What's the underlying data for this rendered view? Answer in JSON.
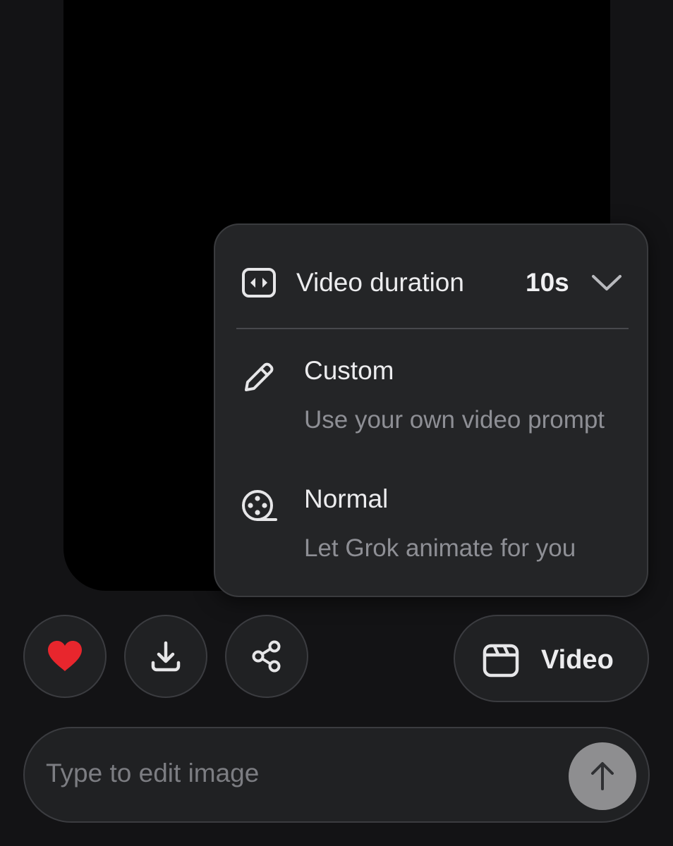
{
  "image_preview": {},
  "video_menu": {
    "duration": {
      "icon": "duration-icon",
      "label": "Video duration",
      "value": "10s",
      "dropdown_icon": "chevron-down-icon"
    },
    "options": [
      {
        "icon": "pencil-icon",
        "title": "Custom",
        "description": "Use your own video prompt"
      },
      {
        "icon": "film-reel-icon",
        "title": "Normal",
        "description": "Let Grok animate for you"
      }
    ]
  },
  "actions": {
    "like": {
      "icon": "heart-icon",
      "liked": true,
      "color": "#e8262d"
    },
    "download": {
      "icon": "download-icon"
    },
    "share": {
      "icon": "share-icon"
    },
    "video": {
      "icon": "clapperboard-icon",
      "label": "Video"
    }
  },
  "prompt": {
    "placeholder": "Type to edit image",
    "value": "",
    "send_icon": "arrow-up-icon"
  }
}
